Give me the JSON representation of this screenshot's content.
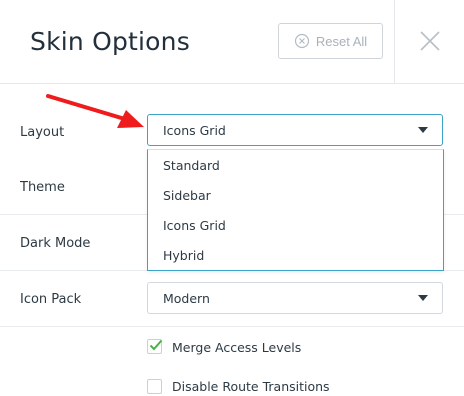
{
  "header": {
    "title": "Skin Options",
    "reset_label": "Reset All",
    "reset_icon": "circle-x-icon",
    "close_icon": "close-icon"
  },
  "fields": {
    "layout": {
      "label": "Layout",
      "value": "Icons Grid"
    },
    "theme": {
      "label": "Theme"
    },
    "dark_mode": {
      "label": "Dark Mode"
    },
    "icon_pack": {
      "label": "Icon Pack",
      "value": "Modern"
    }
  },
  "layout_dropdown": {
    "options": [
      "Standard",
      "Sidebar",
      "Icons Grid",
      "Hybrid"
    ]
  },
  "checkboxes": {
    "merge_access_levels": {
      "label": "Merge Access Levels",
      "checked": true
    },
    "disable_route_transitions": {
      "label": "Disable Route Transitions",
      "checked": false
    }
  },
  "colors": {
    "accent": "#3aa3c7",
    "check": "#4caf50",
    "arrow": "#ee1c1c"
  }
}
